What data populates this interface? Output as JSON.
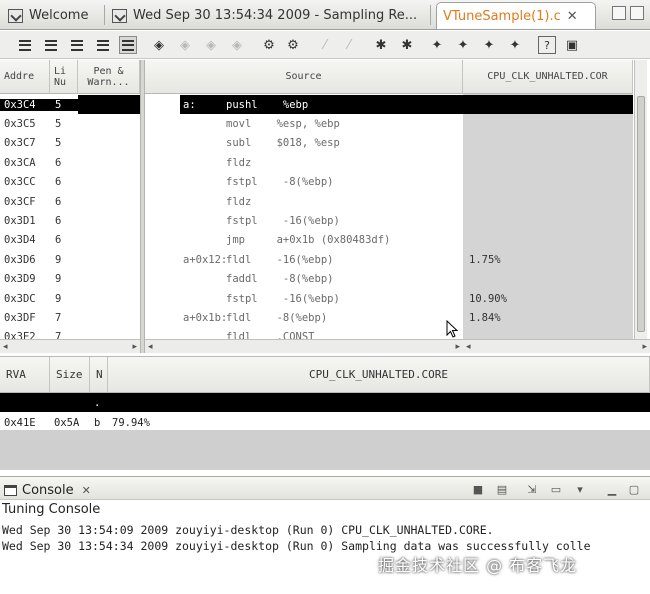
{
  "editor_tabs": [
    {
      "label": "Welcome"
    },
    {
      "label": "Wed Sep 30 13:54:34 2009 - Sampling Re..."
    },
    {
      "label": "VTuneSample(1).c",
      "close": "✕"
    }
  ],
  "toolbar": {
    "icons": [
      "view-lines-icon",
      "view-source-icon",
      "view-asm-icon",
      "view-mixed-icon",
      "view-active-icon",
      "tool-icon-1",
      "tool-icon-2",
      "tool-icon-3",
      "tool-icon-4",
      "tool-icon-5",
      "tool-icon-6",
      "tool-icon-7",
      "tool-icon-8",
      "tool-icon-9",
      "tool-icon-10",
      "tool-icon-11",
      "tool-icon-12",
      "tool-icon-13",
      "help-icon",
      "export-icon"
    ]
  },
  "upper_table": {
    "headers": {
      "address": "Addre",
      "line": "Li\nNu",
      "penalty": "Pen &\nWarn...",
      "source": "Source",
      "event": "CPU_CLK_UNHALTED.COR"
    },
    "rows": [
      {
        "address": "0x3C4",
        "line": "5",
        "label": "a:",
        "code": "pushl    %ebp",
        "event": "",
        "selected": true
      },
      {
        "address": "0x3C5",
        "line": "5",
        "label": "",
        "code": "movl    %esp, %ebp",
        "event": ""
      },
      {
        "address": "0x3C7",
        "line": "5",
        "label": "",
        "code": "subl    $018, %esp",
        "event": ""
      },
      {
        "address": "0x3CA",
        "line": "6",
        "label": "",
        "code": "fldz",
        "event": ""
      },
      {
        "address": "0x3CC",
        "line": "6",
        "label": "",
        "code": "fstpl    -8(%ebp)",
        "event": ""
      },
      {
        "address": "0x3CF",
        "line": "6",
        "label": "",
        "code": "fldz",
        "event": ""
      },
      {
        "address": "0x3D1",
        "line": "6",
        "label": "",
        "code": "fstpl    -16(%ebp)",
        "event": ""
      },
      {
        "address": "0x3D4",
        "line": "6",
        "label": "",
        "code": "jmp     a+0x1b (0x80483df)",
        "event": ""
      },
      {
        "address": "0x3D6",
        "line": "9",
        "label": "a+0x12:",
        "code": "fldl    -16(%ebp)",
        "event": "1.75%"
      },
      {
        "address": "0x3D9",
        "line": "9",
        "label": "",
        "code": "faddl    -8(%ebp)",
        "event": ""
      },
      {
        "address": "0x3DC",
        "line": "9",
        "label": "",
        "code": "fstpl    -16(%ebp)",
        "event": "10.90%"
      },
      {
        "address": "0x3DF",
        "line": "7",
        "label": "a+0x1b:",
        "code": "fldl    -8(%ebp)",
        "event": "1.84%"
      },
      {
        "address": "0x3E2",
        "line": "7",
        "label": "",
        "code": "fldl    .CONST",
        "event": ""
      }
    ]
  },
  "lower_table": {
    "headers": {
      "rva": "RVA",
      "size": "Size",
      "n": "N",
      "event": "CPU_CLK_UNHALTED.CORE"
    },
    "rows": [
      {
        "rva": "",
        "size": "",
        "n": ".",
        "event": "",
        "selected": true
      },
      {
        "rva": "0x41E",
        "size": "0x5A",
        "n": "b",
        "event": "79.94%"
      }
    ]
  },
  "console": {
    "tab_label": "Console",
    "tab_close": "✕",
    "title": "Tuning Console",
    "lines": [
      "Wed Sep 30 13:54:09 2009 zouyiyi-desktop (Run 0) CPU_CLK_UNHALTED.CORE.",
      "Wed Sep 30 13:54:34 2009 zouyiyi-desktop (Run 0) Sampling data was successfully colle"
    ]
  },
  "watermark": "掘金技术社区 @ 布客飞龙"
}
